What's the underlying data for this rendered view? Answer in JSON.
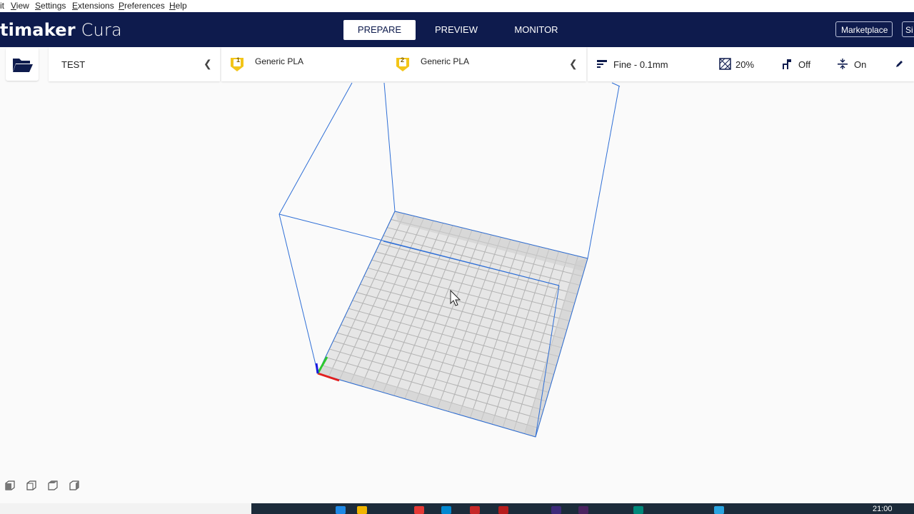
{
  "menu": {
    "items": [
      {
        "label": "it",
        "u": ""
      },
      {
        "label": "View",
        "u": "V"
      },
      {
        "label": "Settings",
        "u": "S"
      },
      {
        "label": "Extensions",
        "u": "E"
      },
      {
        "label": "Preferences",
        "u": "P"
      },
      {
        "label": "Help",
        "u": "H"
      }
    ]
  },
  "app": {
    "logo_bold": "timaker",
    "logo_light": " Cura"
  },
  "tabs": [
    {
      "label": "PREPARE",
      "active": true
    },
    {
      "label": "PREVIEW",
      "active": false
    },
    {
      "label": "MONITOR",
      "active": false
    }
  ],
  "header": {
    "marketplace_label": "Marketplace",
    "signin_label": "Si"
  },
  "printer": {
    "name": "TEST"
  },
  "extruders": [
    {
      "number": "1",
      "material": "Generic PLA"
    },
    {
      "number": "2",
      "material": "Generic PLA"
    }
  ],
  "print_settings": {
    "profile": "Fine - 0.1mm",
    "infill": "20%",
    "support": "Off",
    "adhesion": "On"
  },
  "colors": {
    "header_bg": "#0e1b4d",
    "accent_yellow": "#f3c518",
    "build_volume_lines": "#2f6fd6",
    "grid": "#b3b3b3",
    "plate": "#e6e6e6"
  },
  "taskbar": {
    "time": "21:00"
  }
}
